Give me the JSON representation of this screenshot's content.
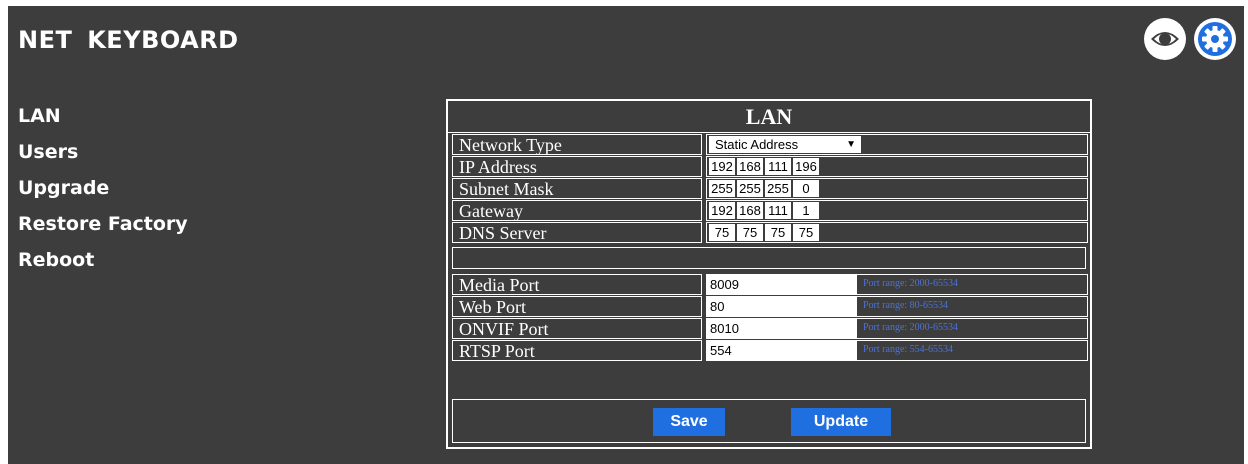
{
  "app": {
    "title": "NET  KEYBOARD"
  },
  "sidebar": {
    "items": [
      {
        "label": "LAN"
      },
      {
        "label": "Users"
      },
      {
        "label": "Upgrade"
      },
      {
        "label": "Restore Factory"
      },
      {
        "label": "Reboot"
      }
    ]
  },
  "header_icons": {
    "view": "eye-icon",
    "settings": "gear-icon"
  },
  "lan": {
    "title": "LAN",
    "network_type": {
      "label": "Network Type",
      "value": "Static Address"
    },
    "ip": {
      "label": "IP Address",
      "octets": [
        "192",
        "168",
        "111",
        "196"
      ]
    },
    "subnet": {
      "label": "Subnet Mask",
      "octets": [
        "255",
        "255",
        "255",
        "0"
      ]
    },
    "gateway": {
      "label": "Gateway",
      "octets": [
        "192",
        "168",
        "111",
        "1"
      ]
    },
    "dns": {
      "label": "DNS Server",
      "octets": [
        "75",
        "75",
        "75",
        "75"
      ]
    },
    "media": {
      "label": "Media Port",
      "value": "8009",
      "hint": "Port range: 2000-65534"
    },
    "web": {
      "label": "Web Port",
      "value": "80",
      "hint": "Port range: 80-65534"
    },
    "onvif": {
      "label": "ONVIF Port",
      "value": "8010",
      "hint": "Port range: 2000-65534"
    },
    "rtsp": {
      "label": "RTSP Port",
      "value": "554",
      "hint": "Port range: 554-65534"
    },
    "save_label": "Save",
    "update_label": "Update"
  },
  "colors": {
    "background": "#3d3d3d",
    "accent": "#1f6fe0",
    "hint": "#4a73d9"
  }
}
